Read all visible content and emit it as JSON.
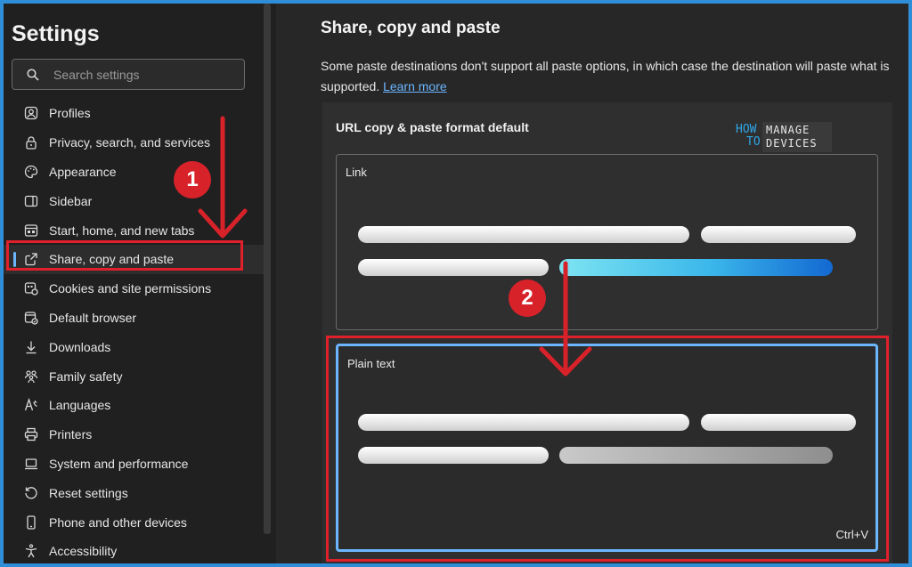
{
  "sidebar": {
    "title": "Settings",
    "search_placeholder": "Search settings",
    "items": [
      {
        "label": "Profiles",
        "icon": "profile-icon"
      },
      {
        "label": "Privacy, search, and services",
        "icon": "lock-icon"
      },
      {
        "label": "Appearance",
        "icon": "palette-icon"
      },
      {
        "label": "Sidebar",
        "icon": "sidebar-icon"
      },
      {
        "label": "Start, home, and new tabs",
        "icon": "home-tabs-icon"
      },
      {
        "label": "Share, copy and paste",
        "icon": "share-icon",
        "active": true
      },
      {
        "label": "Cookies and site permissions",
        "icon": "cookie-icon"
      },
      {
        "label": "Default browser",
        "icon": "browser-icon"
      },
      {
        "label": "Downloads",
        "icon": "download-icon"
      },
      {
        "label": "Family safety",
        "icon": "family-icon"
      },
      {
        "label": "Languages",
        "icon": "language-icon"
      },
      {
        "label": "Printers",
        "icon": "printer-icon"
      },
      {
        "label": "System and performance",
        "icon": "laptop-icon"
      },
      {
        "label": "Reset settings",
        "icon": "reset-icon"
      },
      {
        "label": "Phone and other devices",
        "icon": "phone-icon"
      },
      {
        "label": "Accessibility",
        "icon": "accessibility-icon"
      }
    ]
  },
  "main": {
    "title": "Share, copy and paste",
    "description": "Some paste destinations don't support all paste options, in which case the destination will paste what is supported.",
    "learn_more": "Learn more",
    "card": {
      "title": "URL copy & paste format default",
      "options": [
        {
          "label": "Link",
          "selected": false
        },
        {
          "label": "Plain text",
          "selected": true,
          "shortcut": "Ctrl+V"
        }
      ]
    }
  },
  "watermark": {
    "line1": "HOW",
    "line2": "TO",
    "line3": "MANAGE",
    "line4": "DEVICES"
  },
  "annotations": {
    "step1": "1",
    "step2": "2"
  },
  "colors": {
    "accent": "#6cb6ff",
    "annotation_red": "#d8222a",
    "frame_blue": "#2f8ed8"
  }
}
